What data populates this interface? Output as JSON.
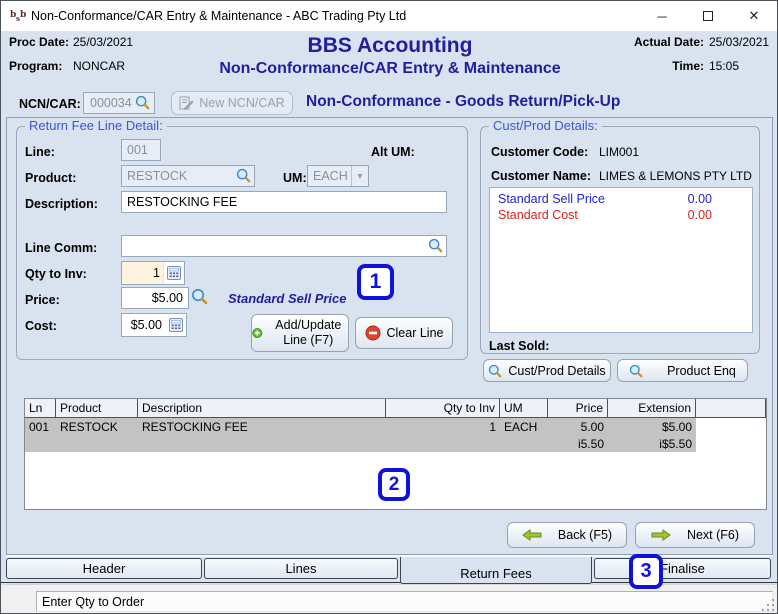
{
  "colors": {
    "window_bg": "#d9e3f0",
    "navy": "#1f1f9e",
    "group_title": "#3a57d0",
    "sell_blue": "#2323cc",
    "cost_red": "#e02020",
    "selected_row": "#c3c3c3",
    "annotation_blue": "#1111dd",
    "disabled_text": "#8a9097",
    "table_header_bg": "#eff1f9"
  },
  "window": {
    "title": "Non-Conformance/CAR Entry & Maintenance - ABC Trading Pty Ltd",
    "icon_text": "bsb",
    "minimize_glyph": "─",
    "close_glyph": "✕"
  },
  "header": {
    "proc_date_label": "Proc Date:",
    "proc_date": "25/03/2021",
    "program_label": "Program:",
    "program": "NONCAR",
    "app_title": "BBS Accounting",
    "screen_title": "Non-Conformance/CAR Entry & Maintenance",
    "actual_date_label": "Actual Date:",
    "actual_date": "25/03/2021",
    "time_label": "Time:",
    "time": "15:05",
    "ncn_label": "NCN/CAR:",
    "ncn_value": "000034",
    "new_button": "New NCN/CAR",
    "doc_type": "Non-Conformance - Goods Return/Pick-Up"
  },
  "return_fee": {
    "group_title": "Return Fee Line Detail:",
    "line_label": "Line:",
    "line_value": "001",
    "alt_um_label": "Alt UM:",
    "product_label": "Product:",
    "product_value": "RESTOCK",
    "um_label": "UM:",
    "um_value": "EACH",
    "description_label": "Description:",
    "description_value": "RESTOCKING FEE",
    "line_comm_label": "Line Comm:",
    "line_comm_value": "",
    "qty_label": "Qty to Inv:",
    "qty_value": "1",
    "price_label": "Price:",
    "price_value": "$5.00",
    "price_note": "Standard Sell Price",
    "cost_label": "Cost:",
    "cost_value": "$5.00",
    "add_update_button": "Add/Update Line (F7)",
    "clear_button": "Clear Line"
  },
  "cust_prod": {
    "group_title": "Cust/Prod Details:",
    "customer_code_label": "Customer Code:",
    "customer_code": "LIM001",
    "customer_name_label": "Customer Name:",
    "customer_name": "LIMES & LEMONS PTY LTD",
    "price_lines": [
      {
        "label": "Standard Sell Price",
        "value": "0.00"
      },
      {
        "label": "Standard Cost",
        "value": "0.00"
      }
    ],
    "last_sold_label": "Last Sold:",
    "details_button": "Cust/Prod Details",
    "product_enq_button": "Product Enq"
  },
  "lines_table": {
    "columns": [
      "Ln",
      "Product",
      "Description",
      "Qty to Inv",
      "UM",
      "Price",
      "Extension"
    ],
    "rows": [
      {
        "ln": "001",
        "product": "RESTOCK",
        "description": "RESTOCKING FEE",
        "qty": "1",
        "um": "EACH",
        "price": "5.00",
        "extension": "$5.00"
      },
      {
        "ln": "",
        "product": "",
        "description": "",
        "qty": "",
        "um": "",
        "price": "i5.50",
        "extension": "i$5.50"
      }
    ]
  },
  "nav": {
    "back_label": "Back (F5)",
    "next_label": "Next (F6)"
  },
  "tabs": [
    {
      "label": "Header",
      "active": false
    },
    {
      "label": "Lines",
      "active": false
    },
    {
      "label": "Return Fees",
      "active": true
    },
    {
      "label": "Finalise",
      "active": false
    }
  ],
  "status": {
    "message": "Enter Qty to Order"
  },
  "annotations": [
    "1",
    "2",
    "3"
  ]
}
